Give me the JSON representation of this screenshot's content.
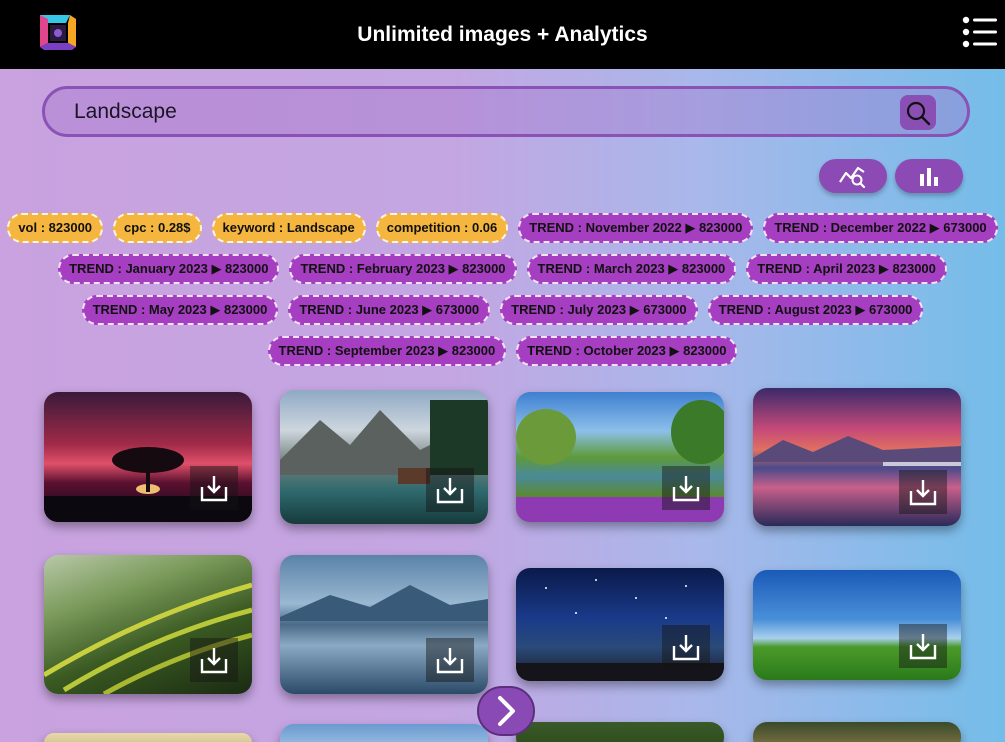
{
  "header": {
    "title": "Unlimited images + Analytics"
  },
  "search": {
    "value": "Landscape"
  },
  "stats": {
    "rows": [
      [
        {
          "label": "vol : 823000",
          "color": "yellow"
        },
        {
          "label": "cpc : 0.28$",
          "color": "yellow"
        },
        {
          "label": "keyword : Landscape",
          "color": "yellow"
        },
        {
          "label": "competition : 0.06",
          "color": "yellow"
        },
        {
          "label": "TREND : November 2022 ▶ 823000",
          "color": "purple"
        },
        {
          "label": "TREND : December 2022 ▶ 673000",
          "color": "purple"
        }
      ],
      [
        {
          "label": "TREND : January 2023 ▶ 823000",
          "color": "purple"
        },
        {
          "label": "TREND : February 2023 ▶ 823000",
          "color": "purple"
        },
        {
          "label": "TREND : March 2023 ▶ 823000",
          "color": "purple"
        },
        {
          "label": "TREND : April 2023 ▶ 823000",
          "color": "purple"
        }
      ],
      [
        {
          "label": "TREND : May 2023 ▶ 823000",
          "color": "purple"
        },
        {
          "label": "TREND : June 2023 ▶ 673000",
          "color": "purple"
        },
        {
          "label": "TREND : July 2023 ▶ 673000",
          "color": "purple"
        },
        {
          "label": "TREND : August 2023 ▶ 673000",
          "color": "purple"
        }
      ],
      [
        {
          "label": "TREND : September 2023 ▶ 823000",
          "color": "purple"
        },
        {
          "label": "TREND : October 2023 ▶ 823000",
          "color": "purple"
        }
      ]
    ]
  },
  "colors": {
    "header_bg": "#000000",
    "accent": "#8b4ab4",
    "tag_yellow": "#f5b63f",
    "tag_purple": "#a53ec0"
  },
  "icons": [
    "app-logo-icon",
    "hamburger-menu-icon",
    "search-icon",
    "trend-analytics-icon",
    "bar-chart-icon",
    "download-icon",
    "chevron-right-icon"
  ]
}
